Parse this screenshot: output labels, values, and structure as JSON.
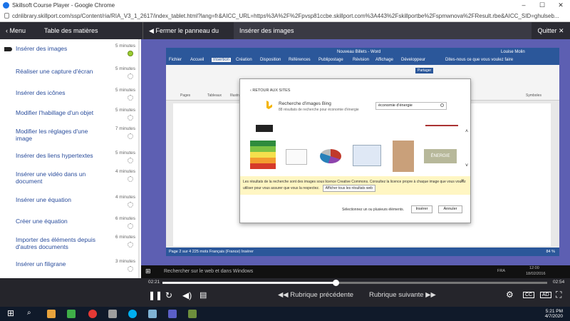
{
  "browser": {
    "title": "Skillsoft Course Player - Google Chrome",
    "url": "cdnlibrary.skillport.com/ssp/Content/ria/RIA_V3_1_2617/index_tablet.html?lang=fr&AICC_URL=https%3A%2F%2Fpvsp81ccbe.skillport.com%3A443%2Fskillportbe%2Fspmwnova%2FResult.rbe&AICC_SID=ghulseb..."
  },
  "course_header": {
    "menu_label": "Menu",
    "toc_label": "Table des matières",
    "close_panel_label": "Fermer le panneau du menu",
    "current_topic": "Insérer des images",
    "quit_label": "Quitter"
  },
  "toc": [
    {
      "title": "Insérer des images",
      "duration": "5 minutes",
      "status": "complete"
    },
    {
      "title": "Réaliser une capture d'écran",
      "duration": "5 minutes",
      "status": "not-started"
    },
    {
      "title": "Insérer des icônes",
      "duration": "5 minutes",
      "status": "not-started"
    },
    {
      "title": "Modifier l'habillage d'un objet",
      "duration": "5 minutes",
      "status": "not-started"
    },
    {
      "title": "Modifier les réglages d'une image",
      "duration": "7 minutes",
      "status": "not-started"
    },
    {
      "title": "Insérer des liens hypertextes",
      "duration": "5 minutes",
      "status": "not-started"
    },
    {
      "title": "Insérer une vidéo dans un document",
      "duration": "4 minutes",
      "status": "not-started"
    },
    {
      "title": "Insérer une équation",
      "duration": "4 minutes",
      "status": "not-started"
    },
    {
      "title": "Créer une équation",
      "duration": "6 minutes",
      "status": "not-started"
    },
    {
      "title": "Importer des éléments depuis d'autres documents",
      "duration": "6 minutes",
      "status": "not-started"
    },
    {
      "title": "Insérer un filigrane",
      "duration": "3 minutes",
      "status": "not-started"
    }
  ],
  "word": {
    "title": "Nouveau Billets - Word",
    "tabs": [
      "Fichier",
      "Accueil",
      "Insertion",
      "Création",
      "Disposition",
      "Références",
      "Publipostage",
      "Révision",
      "Affichage",
      "Développeur"
    ],
    "tell_me": "Dites-nous ce que vous voulez faire",
    "user": "Louise Molin",
    "share": "Partager",
    "ribbon_groups": [
      "Pages",
      "Tableaux",
      "Illustrations",
      "Symboles"
    ],
    "status_text": "Page 2 sur 4    225 mots    Français (France)    Insérer",
    "zoom": "84 %"
  },
  "dialog": {
    "back_label": "RETOUR AUX SITES",
    "source_title": "Recherche d'images Bing",
    "result_count": "88 résultats de recherche pour économie d'énergie",
    "search_value": "économie d'énergie",
    "notice": "Les résultats de la recherche sont des images sous licence Creative Commons. Consultez la licence propre à chaque image que vous voulez utiliser pour vous assurer que vous la respectez.",
    "show_all_label": "Afficher tous les résultats web",
    "select_hint": "Sélectionnez un ou plusieurs éléments.",
    "insert_label": "Insérer",
    "cancel_label": "Annuler",
    "thumbnail_caption": "ÉNERGIE"
  },
  "video_taskbar": {
    "search_placeholder": "Rechercher sur le web et dans Windows",
    "time": "12:00",
    "date": "18/02/2016",
    "lang": "FRA"
  },
  "player": {
    "elapsed": "02:21",
    "total": "02:54",
    "progress_fraction": 0.45,
    "prev_label": "Rubrique précédente",
    "next_label": "Rubrique suivante",
    "cc_label": "CC",
    "ad_label": "AD"
  },
  "os_taskbar": {
    "time": "5:21 PM",
    "date": "4/7/2020"
  }
}
